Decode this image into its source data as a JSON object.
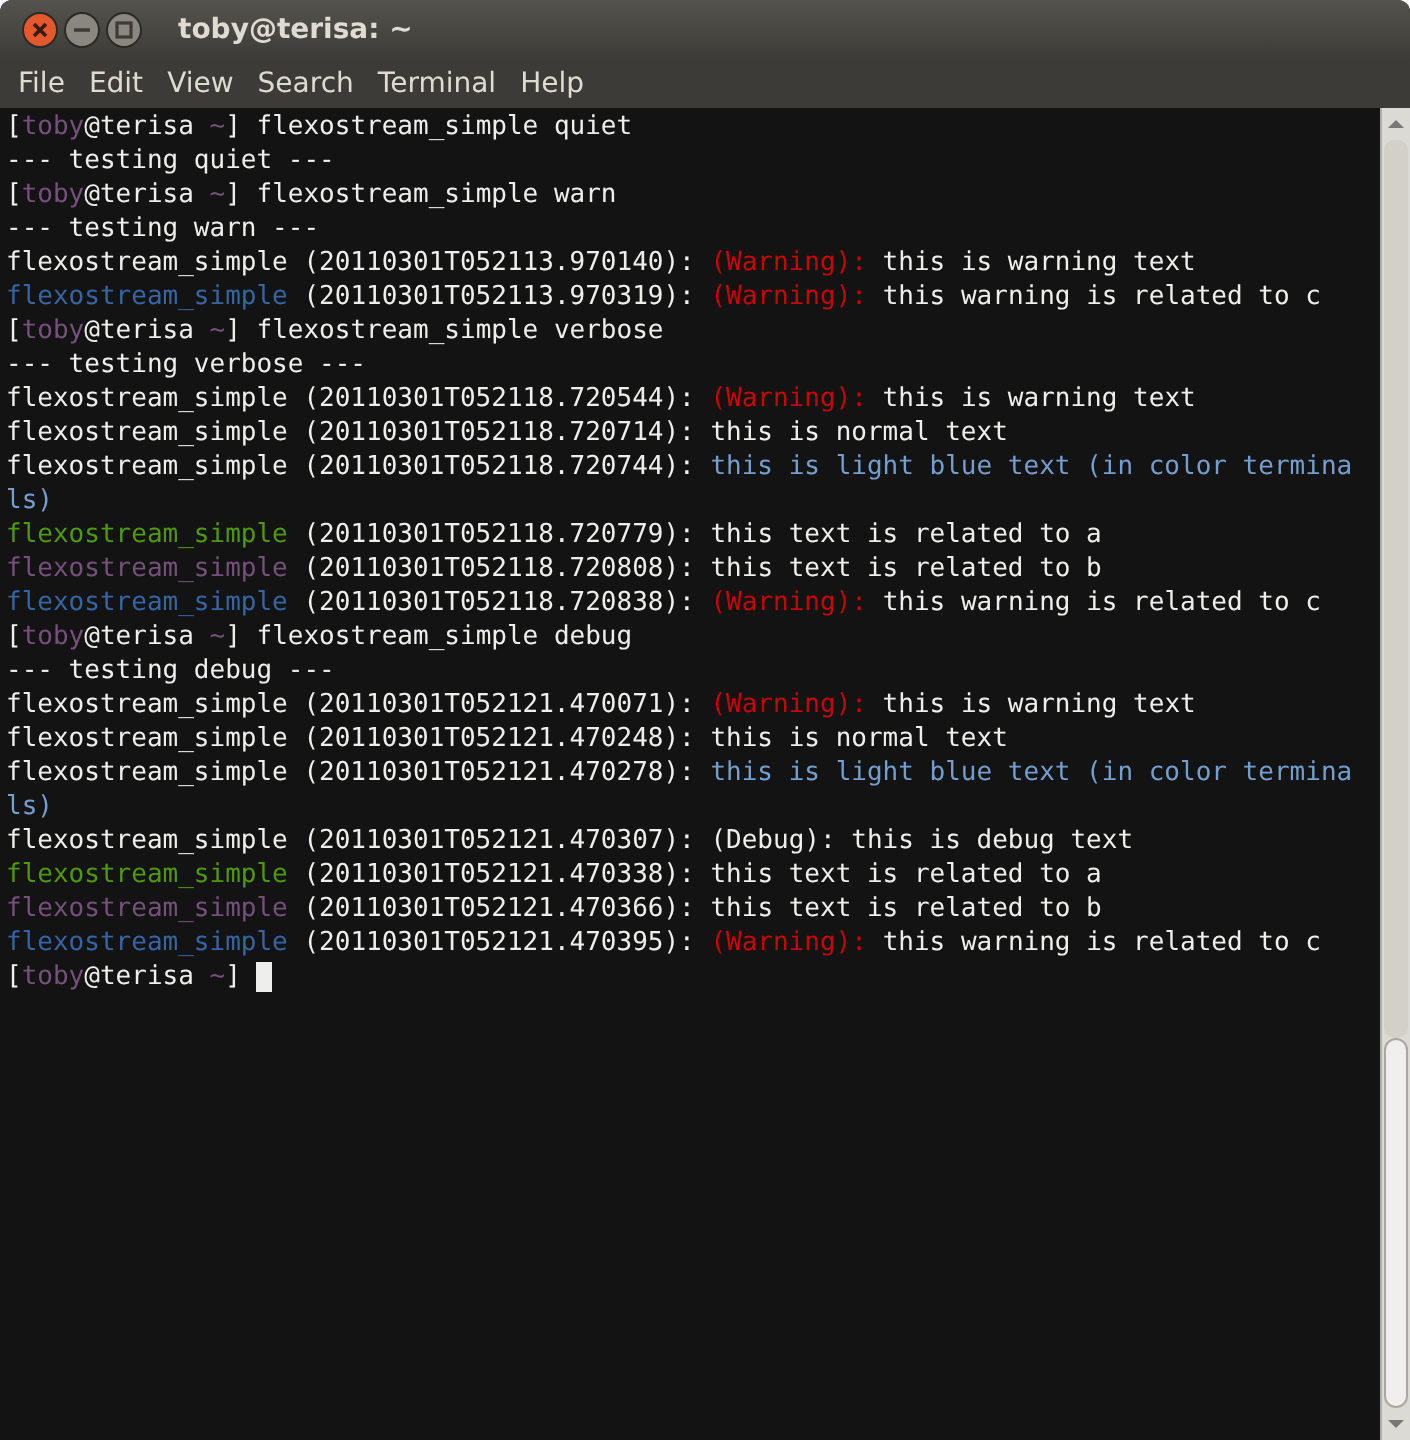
{
  "window": {
    "title": "toby@terisa: ~"
  },
  "menu": [
    "File",
    "Edit",
    "View",
    "Search",
    "Terminal",
    "Help"
  ],
  "lines": [
    {
      "segments": [
        {
          "text": "[",
          "color": "#eeeeec"
        },
        {
          "text": "toby",
          "color": "#75507b"
        },
        {
          "text": "@terisa ",
          "color": "#eeeeec"
        },
        {
          "text": "~",
          "color": "#75507b"
        },
        {
          "text": "] flexostream_simple quiet",
          "color": "#eeeeec"
        }
      ]
    },
    {
      "segments": [
        {
          "text": "--- testing quiet ---",
          "color": "#eeeeec"
        }
      ]
    },
    {
      "segments": [
        {
          "text": "[",
          "color": "#eeeeec"
        },
        {
          "text": "toby",
          "color": "#75507b"
        },
        {
          "text": "@terisa ",
          "color": "#eeeeec"
        },
        {
          "text": "~",
          "color": "#75507b"
        },
        {
          "text": "] flexostream_simple warn",
          "color": "#eeeeec"
        }
      ]
    },
    {
      "segments": [
        {
          "text": "--- testing warn ---",
          "color": "#eeeeec"
        }
      ]
    },
    {
      "segments": [
        {
          "text": "flexostream_simple (20110301T052113.970140): ",
          "color": "#eeeeec"
        },
        {
          "text": "(Warning):",
          "color": "#cc0000"
        },
        {
          "text": " this is warning text",
          "color": "#eeeeec"
        }
      ]
    },
    {
      "segments": [
        {
          "text": "flexostream_simple",
          "color": "#3465a4"
        },
        {
          "text": " (20110301T052113.970319): ",
          "color": "#eeeeec"
        },
        {
          "text": "(Warning):",
          "color": "#cc0000"
        },
        {
          "text": " this warning is related to c",
          "color": "#eeeeec"
        }
      ]
    },
    {
      "segments": [
        {
          "text": "[",
          "color": "#eeeeec"
        },
        {
          "text": "toby",
          "color": "#75507b"
        },
        {
          "text": "@terisa ",
          "color": "#eeeeec"
        },
        {
          "text": "~",
          "color": "#75507b"
        },
        {
          "text": "] flexostream_simple verbose",
          "color": "#eeeeec"
        }
      ]
    },
    {
      "segments": [
        {
          "text": "--- testing verbose ---",
          "color": "#eeeeec"
        }
      ]
    },
    {
      "segments": [
        {
          "text": "flexostream_simple (20110301T052118.720544): ",
          "color": "#eeeeec"
        },
        {
          "text": "(Warning):",
          "color": "#cc0000"
        },
        {
          "text": " this is warning text",
          "color": "#eeeeec"
        }
      ]
    },
    {
      "segments": [
        {
          "text": "flexostream_simple (20110301T052118.720714): this is normal text",
          "color": "#eeeeec"
        }
      ]
    },
    {
      "segments": [
        {
          "text": "flexostream_simple (20110301T052118.720744): ",
          "color": "#eeeeec"
        },
        {
          "text": "this is light blue text (in color termina",
          "color": "#729fcf"
        }
      ]
    },
    {
      "segments": [
        {
          "text": "ls)",
          "color": "#729fcf"
        }
      ]
    },
    {
      "segments": [
        {
          "text": "flexostream_simple",
          "color": "#4e9a06"
        },
        {
          "text": " (20110301T052118.720779): this text is related to a",
          "color": "#eeeeec"
        }
      ]
    },
    {
      "segments": [
        {
          "text": "flexostream_simple",
          "color": "#75507b"
        },
        {
          "text": " (20110301T052118.720808): this text is related to b",
          "color": "#eeeeec"
        }
      ]
    },
    {
      "segments": [
        {
          "text": "flexostream_simple",
          "color": "#3465a4"
        },
        {
          "text": " (20110301T052118.720838): ",
          "color": "#eeeeec"
        },
        {
          "text": "(Warning):",
          "color": "#cc0000"
        },
        {
          "text": " this warning is related to c",
          "color": "#eeeeec"
        }
      ]
    },
    {
      "segments": [
        {
          "text": "[",
          "color": "#eeeeec"
        },
        {
          "text": "toby",
          "color": "#75507b"
        },
        {
          "text": "@terisa ",
          "color": "#eeeeec"
        },
        {
          "text": "~",
          "color": "#75507b"
        },
        {
          "text": "] flexostream_simple debug",
          "color": "#eeeeec"
        }
      ]
    },
    {
      "segments": [
        {
          "text": "--- testing debug ---",
          "color": "#eeeeec"
        }
      ]
    },
    {
      "segments": [
        {
          "text": "flexostream_simple (20110301T052121.470071): ",
          "color": "#eeeeec"
        },
        {
          "text": "(Warning):",
          "color": "#cc0000"
        },
        {
          "text": " this is warning text",
          "color": "#eeeeec"
        }
      ]
    },
    {
      "segments": [
        {
          "text": "flexostream_simple (20110301T052121.470248): this is normal text",
          "color": "#eeeeec"
        }
      ]
    },
    {
      "segments": [
        {
          "text": "flexostream_simple (20110301T052121.470278): ",
          "color": "#eeeeec"
        },
        {
          "text": "this is light blue text (in color termina",
          "color": "#729fcf"
        }
      ]
    },
    {
      "segments": [
        {
          "text": "ls)",
          "color": "#729fcf"
        }
      ]
    },
    {
      "segments": [
        {
          "text": "flexostream_simple (20110301T052121.470307): (Debug): this is debug text",
          "color": "#eeeeec"
        }
      ]
    },
    {
      "segments": [
        {
          "text": "flexostream_simple",
          "color": "#4e9a06"
        },
        {
          "text": " (20110301T052121.470338): this text is related to a",
          "color": "#eeeeec"
        }
      ]
    },
    {
      "segments": [
        {
          "text": "flexostream_simple",
          "color": "#75507b"
        },
        {
          "text": " (20110301T052121.470366): this text is related to b",
          "color": "#eeeeec"
        }
      ]
    },
    {
      "segments": [
        {
          "text": "flexostream_simple",
          "color": "#3465a4"
        },
        {
          "text": " (20110301T052121.470395): ",
          "color": "#eeeeec"
        },
        {
          "text": "(Warning):",
          "color": "#cc0000"
        },
        {
          "text": " this warning is related to c",
          "color": "#eeeeec"
        }
      ]
    },
    {
      "segments": [
        {
          "text": "[",
          "color": "#eeeeec"
        },
        {
          "text": "toby",
          "color": "#75507b"
        },
        {
          "text": "@terisa ",
          "color": "#eeeeec"
        },
        {
          "text": "~",
          "color": "#75507b"
        },
        {
          "text": "]",
          "color": "#eeeeec"
        }
      ]
    }
  ]
}
